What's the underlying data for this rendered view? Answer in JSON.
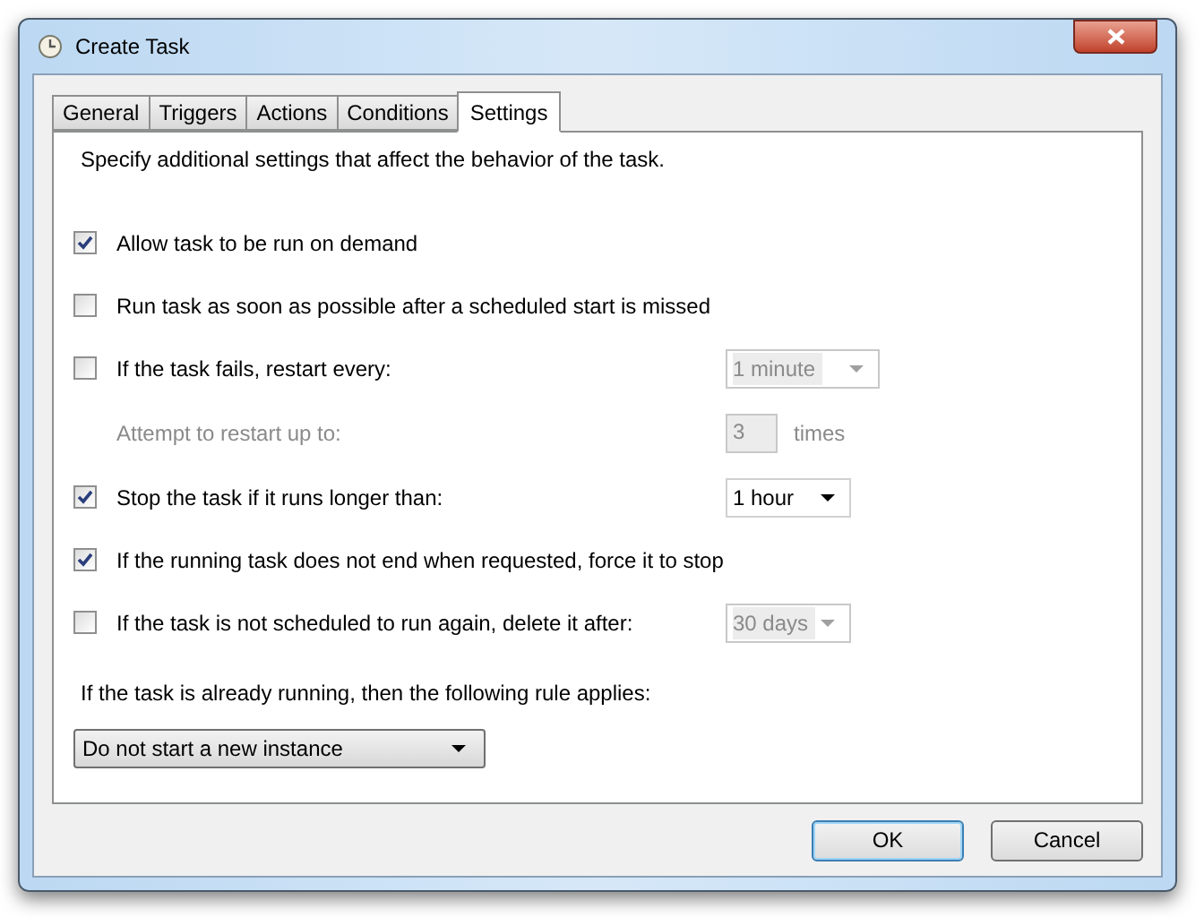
{
  "window": {
    "title": "Create Task"
  },
  "tabs": [
    {
      "label": "General",
      "selected": false
    },
    {
      "label": "Triggers",
      "selected": false
    },
    {
      "label": "Actions",
      "selected": false
    },
    {
      "label": "Conditions",
      "selected": false
    },
    {
      "label": "Settings",
      "selected": true
    }
  ],
  "description": "Specify additional settings that affect the behavior of the task.",
  "options": [
    {
      "kind": "checkbox",
      "label": "Allow task to be run on demand",
      "checked": true
    },
    {
      "kind": "checkbox",
      "label": "Run task as soon as possible after a scheduled start is missed",
      "checked": false
    },
    {
      "kind": "checkbox",
      "label": "If the task fails, restart every:",
      "checked": false,
      "dropdown": {
        "value": "1 minute",
        "disabled": true
      }
    },
    {
      "kind": "spin",
      "label": "Attempt to restart up to:",
      "value": "3",
      "suffix": "times",
      "disabled": true
    },
    {
      "kind": "checkbox",
      "label": "Stop the task if it runs longer than:",
      "checked": true,
      "dropdown": {
        "value": "1 hour",
        "disabled": false
      }
    },
    {
      "kind": "checkbox",
      "label": "If the running task does not end when requested, force it to stop",
      "checked": true
    },
    {
      "kind": "checkbox",
      "label": "If the task is not scheduled to run again, delete it after:",
      "checked": false,
      "dropdown": {
        "value": "30 days",
        "disabled": true
      }
    }
  ],
  "rule_label": "If the task is already running, then the following rule applies:",
  "rule_dropdown": {
    "value": "Do not start a new instance"
  },
  "buttons": [
    {
      "label": "OK",
      "default": true
    },
    {
      "label": "Cancel",
      "default": false
    }
  ]
}
